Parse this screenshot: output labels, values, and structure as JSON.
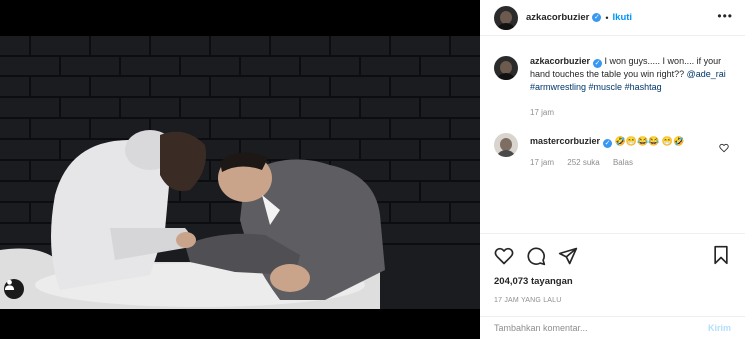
{
  "post": {
    "author": "azkacorbuzier",
    "follow_label": "Ikuti",
    "dot": "•",
    "more_icon": "more-horizontal-icon"
  },
  "caption": {
    "author": "azkacorbuzier",
    "text": " I won guys..... I won.... if your hand touches the table you win right?? ",
    "mention": "@ade_rai",
    "hashtags": [
      "#armwrestling",
      "#muscle",
      "#hashtag"
    ],
    "time": "17 jam"
  },
  "comment": {
    "author": "mastercorbuzier",
    "emojis": "🤣😁😂😂 😁🤣",
    "time": "17 jam",
    "likes": "252 suka",
    "reply_label": "Balas"
  },
  "stats": {
    "views": "204,073 tayangan",
    "posted": "17 JAM YANG LALU"
  },
  "composer": {
    "placeholder": "Tambahkan komentar...",
    "post_label": "Kirim"
  },
  "colors": {
    "accent": "#0095f6",
    "verified": "#3897f0",
    "muted": "#8e8e8e",
    "link": "#00376b"
  }
}
